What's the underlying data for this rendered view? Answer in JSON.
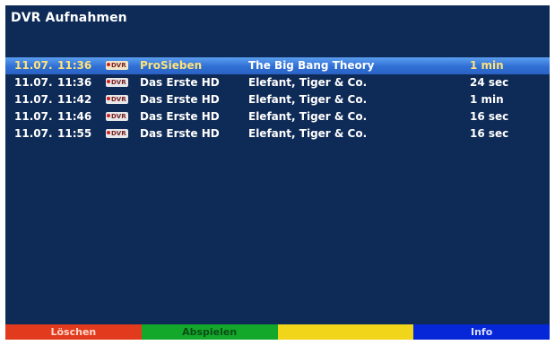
{
  "screen": {
    "title": "DVR Aufnahmen"
  },
  "recordings": [
    {
      "date": "11.07.",
      "time": "11:36",
      "badge": "DVR",
      "channel": "ProSieben",
      "title": "The Big Bang Theory",
      "duration": "1 min",
      "selected": true
    },
    {
      "date": "11.07.",
      "time": "11:36",
      "badge": "DVR",
      "channel": "Das Erste HD",
      "title": "Elefant, Tiger & Co.",
      "duration": "24 sec",
      "selected": false
    },
    {
      "date": "11.07.",
      "time": "11:42",
      "badge": "DVR",
      "channel": "Das Erste HD",
      "title": "Elefant, Tiger & Co.",
      "duration": "1 min",
      "selected": false
    },
    {
      "date": "11.07.",
      "time": "11:46",
      "badge": "DVR",
      "channel": "Das Erste HD",
      "title": "Elefant, Tiger & Co.",
      "duration": "16 sec",
      "selected": false
    },
    {
      "date": "11.07.",
      "time": "11:55",
      "badge": "DVR",
      "channel": "Das Erste HD",
      "title": "Elefant, Tiger & Co.",
      "duration": "16 sec",
      "selected": false
    }
  ],
  "footer": {
    "red_label": "Löschen",
    "green_label": "Abspielen",
    "yellow_label": "",
    "blue_label": "Info"
  },
  "colors": {
    "background": "#0e2a56",
    "selection": "#2f6fd4",
    "red_key": "#e23a1c",
    "green_key": "#14a82b",
    "yellow_key": "#f1d51b",
    "blue_key": "#0627d8"
  }
}
